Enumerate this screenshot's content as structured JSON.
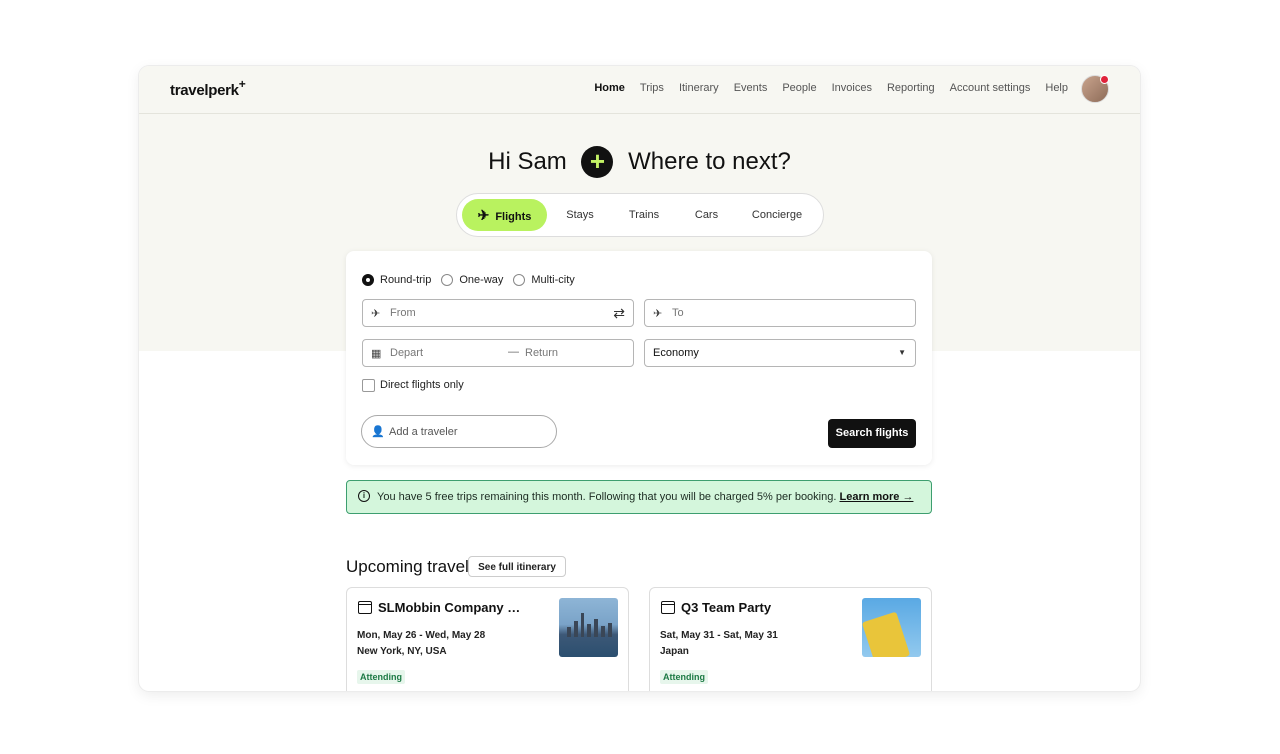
{
  "brand": {
    "logo": "travelperk",
    "logo_mark": "+"
  },
  "nav": {
    "items": [
      "Home",
      "Trips",
      "Itinerary",
      "Events",
      "People",
      "Invoices",
      "Reporting",
      "Account settings",
      "Help"
    ],
    "active": "Home"
  },
  "greeting": {
    "hi": "Hi Sam",
    "plus": "+",
    "question": "Where to next?"
  },
  "tabs": [
    {
      "label": "Flights",
      "active": true
    },
    {
      "label": "Stays"
    },
    {
      "label": "Trains"
    },
    {
      "label": "Cars"
    },
    {
      "label": "Concierge"
    }
  ],
  "trip_type": {
    "options": [
      "Round-trip",
      "One-way",
      "Multi-city"
    ],
    "selected": "Round-trip"
  },
  "search": {
    "from_placeholder": "From",
    "to_placeholder": "To",
    "depart_placeholder": "Depart",
    "dash": "—",
    "return_placeholder": "Return",
    "cabin": "Economy",
    "direct_label": "Direct flights only",
    "traveler_placeholder": "Add a traveler",
    "search_button": "Search flights"
  },
  "notice": {
    "text": "You have 5 free trips remaining this month. Following that you will be charged 5% per booking.",
    "link": "Learn more →",
    "color": "#d4f6dc"
  },
  "upcoming": {
    "title": "Upcoming travel",
    "see_all": "See full itinerary",
    "trips": [
      {
        "title": "SLMobbin Company Party",
        "dates": "Mon, May 26 - Wed, May 28",
        "location": "New York, NY, USA",
        "status": "Attending"
      },
      {
        "title": "Q3 Team Party",
        "dates": "Sat, May 31 - Sat, May 31",
        "location": "Japan",
        "status": "Attending"
      }
    ]
  },
  "colors": {
    "accent": "#b9f25f",
    "hero_bg": "#f7f7f2",
    "notice_border": "#3d9e6f"
  }
}
